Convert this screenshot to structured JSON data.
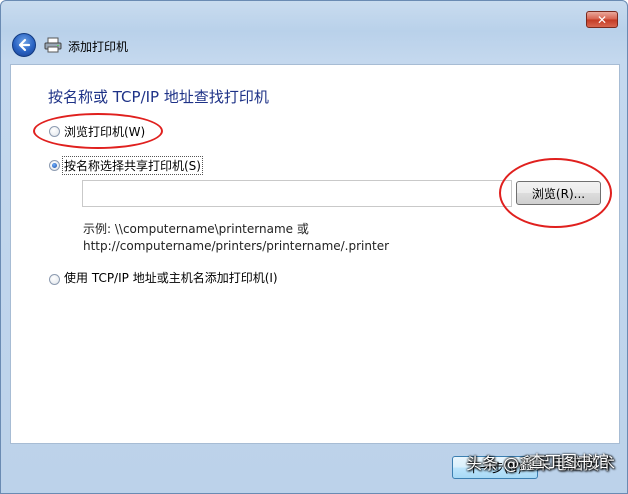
{
  "window": {
    "title": "添加打印机",
    "close_label": "✕"
  },
  "main": {
    "heading": "按名称或 TCP/IP 地址查找打印机",
    "options": [
      {
        "label": "浏览打印机(W)",
        "checked": false
      },
      {
        "label": "按名称选择共享打印机(S)",
        "checked": true
      },
      {
        "label": "使用 TCP/IP 地址或主机名添加打印机(I)",
        "checked": false
      }
    ],
    "path_value": "",
    "browse_label": "浏览(R)...",
    "example_line1": "示例: \\\\computername\\printername 或",
    "example_line2": "http://computername/printers/printername/.printer"
  },
  "footer": {
    "next_label": "下一步(N)"
  },
  "watermark": {
    "line1": "头条 @鑫呆电脑技术",
    "line2": "查丁图书馆"
  },
  "annotations": {
    "ellipse_color": "#e0201e"
  }
}
